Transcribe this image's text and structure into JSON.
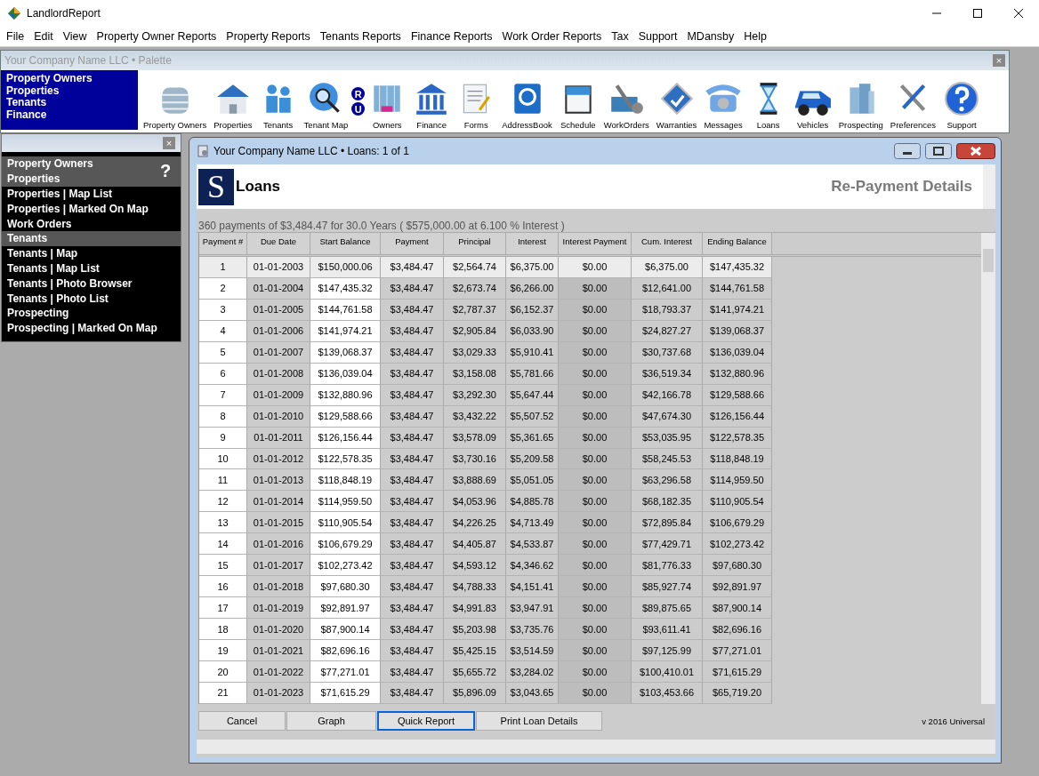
{
  "window": {
    "title": "LandlordReport"
  },
  "menu": [
    "File",
    "Edit",
    "View",
    "Property Owner Reports",
    "Property Reports",
    "Tenants Reports",
    "Finance Reports",
    "Work Order Reports",
    "Tax",
    "Support",
    "MDansby",
    "Help"
  ],
  "palette": {
    "title": "Your Company Name LLC  • Palette",
    "links": [
      "Property Owners",
      "Properties",
      "Tenants",
      "Finance"
    ],
    "badges": [
      "R",
      "U"
    ],
    "tools": [
      {
        "label": "Property Owners"
      },
      {
        "label": "Properties"
      },
      {
        "label": "Tenants"
      },
      {
        "label": "Tenant Map"
      },
      {
        "label": "Owners"
      },
      {
        "label": "Finance"
      },
      {
        "label": "Forms"
      },
      {
        "label": "AddressBook"
      },
      {
        "label": "Schedule"
      },
      {
        "label": "WorkOrders"
      },
      {
        "label": "Warranties"
      },
      {
        "label": "Messages"
      },
      {
        "label": "Loans"
      },
      {
        "label": "Vehicles"
      },
      {
        "label": "Prospecting"
      },
      {
        "label": "Preferences"
      },
      {
        "label": "Support"
      }
    ],
    "close": "×"
  },
  "nav": {
    "close": "×",
    "help": "?",
    "items": [
      {
        "label": "Property Owners",
        "kind": "header"
      },
      {
        "label": "Properties",
        "kind": "header"
      },
      {
        "label": "Properties | Map List",
        "kind": "link"
      },
      {
        "label": "Properties | Marked On Map",
        "kind": "link"
      },
      {
        "label": "Work Orders",
        "kind": "link"
      },
      {
        "label": "Tenants",
        "kind": "header"
      },
      {
        "label": "Tenants | Map",
        "kind": "link"
      },
      {
        "label": "Tenants | Map List",
        "kind": "link"
      },
      {
        "label": "Tenants | Photo Browser",
        "kind": "link"
      },
      {
        "label": "Tenants | Photo List",
        "kind": "link"
      },
      {
        "label": "Prospecting",
        "kind": "link"
      },
      {
        "label": "Prospecting | Marked On Map",
        "kind": "link"
      }
    ]
  },
  "loan_window": {
    "title": "Your Company Name LLC  •  Loans: 1 of 1",
    "logo": "S",
    "heading": "Loans",
    "subheading": "Re-Payment Details",
    "summary": "360 payments of  $3,484.47 for 30.0 Years (  $575,000.00 at 6.100 % Interest )",
    "table": {
      "columns": [
        "Payment #",
        "Due Date",
        "Start Balance",
        "Payment",
        "Principal",
        "Interest",
        "Interest Payment",
        "Cum. Interest",
        "Ending Balance"
      ],
      "rows": [
        {
          "selected": true,
          "cells": [
            "1",
            "01-01-2003",
            "$150,000.06",
            "$3,484.47",
            "$2,564.74",
            "$6,375.00",
            "$0.00",
            "$6,375.00",
            "$147,435.32"
          ]
        },
        {
          "selected": false,
          "cells": [
            "2",
            "01-01-2004",
            "$147,435.32",
            "$3,484.47",
            "$2,673.74",
            "$6,266.00",
            "$0.00",
            "$12,641.00",
            "$144,761.58"
          ]
        },
        {
          "selected": false,
          "cells": [
            "3",
            "01-01-2005",
            "$144,761.58",
            "$3,484.47",
            "$2,787.37",
            "$6,152.37",
            "$0.00",
            "$18,793.37",
            "$141,974.21"
          ]
        },
        {
          "selected": false,
          "cells": [
            "4",
            "01-01-2006",
            "$141,974.21",
            "$3,484.47",
            "$2,905.84",
            "$6,033.90",
            "$0.00",
            "$24,827.27",
            "$139,068.37"
          ]
        },
        {
          "selected": false,
          "cells": [
            "5",
            "01-01-2007",
            "$139,068.37",
            "$3,484.47",
            "$3,029.33",
            "$5,910.41",
            "$0.00",
            "$30,737.68",
            "$136,039.04"
          ]
        },
        {
          "selected": false,
          "cells": [
            "6",
            "01-01-2008",
            "$136,039.04",
            "$3,484.47",
            "$3,158.08",
            "$5,781.66",
            "$0.00",
            "$36,519.34",
            "$132,880.96"
          ]
        },
        {
          "selected": false,
          "cells": [
            "7",
            "01-01-2009",
            "$132,880.96",
            "$3,484.47",
            "$3,292.30",
            "$5,647.44",
            "$0.00",
            "$42,166.78",
            "$129,588.66"
          ]
        },
        {
          "selected": false,
          "cells": [
            "8",
            "01-01-2010",
            "$129,588.66",
            "$3,484.47",
            "$3,432.22",
            "$5,507.52",
            "$0.00",
            "$47,674.30",
            "$126,156.44"
          ]
        },
        {
          "selected": false,
          "cells": [
            "9",
            "01-01-2011",
            "$126,156.44",
            "$3,484.47",
            "$3,578.09",
            "$5,361.65",
            "$0.00",
            "$53,035.95",
            "$122,578.35"
          ]
        },
        {
          "selected": false,
          "cells": [
            "10",
            "01-01-2012",
            "$122,578.35",
            "$3,484.47",
            "$3,730.16",
            "$5,209.58",
            "$0.00",
            "$58,245.53",
            "$118,848.19"
          ]
        },
        {
          "selected": false,
          "cells": [
            "11",
            "01-01-2013",
            "$118,848.19",
            "$3,484.47",
            "$3,888.69",
            "$5,051.05",
            "$0.00",
            "$63,296.58",
            "$114,959.50"
          ]
        },
        {
          "selected": false,
          "cells": [
            "12",
            "01-01-2014",
            "$114,959.50",
            "$3,484.47",
            "$4,053.96",
            "$4,885.78",
            "$0.00",
            "$68,182.35",
            "$110,905.54"
          ]
        },
        {
          "selected": false,
          "cells": [
            "13",
            "01-01-2015",
            "$110,905.54",
            "$3,484.47",
            "$4,226.25",
            "$4,713.49",
            "$0.00",
            "$72,895.84",
            "$106,679.29"
          ]
        },
        {
          "selected": false,
          "cells": [
            "14",
            "01-01-2016",
            "$106,679.29",
            "$3,484.47",
            "$4,405.87",
            "$4,533.87",
            "$0.00",
            "$77,429.71",
            "$102,273.42"
          ]
        },
        {
          "selected": false,
          "cells": [
            "15",
            "01-01-2017",
            "$102,273.42",
            "$3,484.47",
            "$4,593.12",
            "$4,346.62",
            "$0.00",
            "$81,776.33",
            "$97,680.30"
          ]
        },
        {
          "selected": false,
          "cells": [
            "16",
            "01-01-2018",
            "$97,680.30",
            "$3,484.47",
            "$4,788.33",
            "$4,151.41",
            "$0.00",
            "$85,927.74",
            "$92,891.97"
          ]
        },
        {
          "selected": false,
          "cells": [
            "17",
            "01-01-2019",
            "$92,891.97",
            "$3,484.47",
            "$4,991.83",
            "$3,947.91",
            "$0.00",
            "$89,875.65",
            "$87,900.14"
          ]
        },
        {
          "selected": false,
          "cells": [
            "18",
            "01-01-2020",
            "$87,900.14",
            "$3,484.47",
            "$5,203.98",
            "$3,735.76",
            "$0.00",
            "$93,611.41",
            "$82,696.16"
          ]
        },
        {
          "selected": false,
          "cells": [
            "19",
            "01-01-2021",
            "$82,696.16",
            "$3,484.47",
            "$5,425.15",
            "$3,514.59",
            "$0.00",
            "$97,125.99",
            "$77,271.01"
          ]
        },
        {
          "selected": false,
          "cells": [
            "20",
            "01-01-2022",
            "$77,271.01",
            "$3,484.47",
            "$5,655.72",
            "$3,284.02",
            "$0.00",
            "$100,410.01",
            "$71,615.29"
          ]
        },
        {
          "selected": false,
          "cells": [
            "21",
            "01-01-2023",
            "$71,615.29",
            "$3,484.47",
            "$5,896.09",
            "$3,043.65",
            "$0.00",
            "$103,453.66",
            "$65,719.20"
          ]
        }
      ]
    },
    "buttons": [
      {
        "label": "Cancel",
        "focused": false
      },
      {
        "label": "Graph",
        "focused": false
      },
      {
        "label": "Quick Report",
        "focused": true
      },
      {
        "label": "Print Loan Details",
        "focused": false
      }
    ],
    "version": "v 2016 Universal"
  }
}
